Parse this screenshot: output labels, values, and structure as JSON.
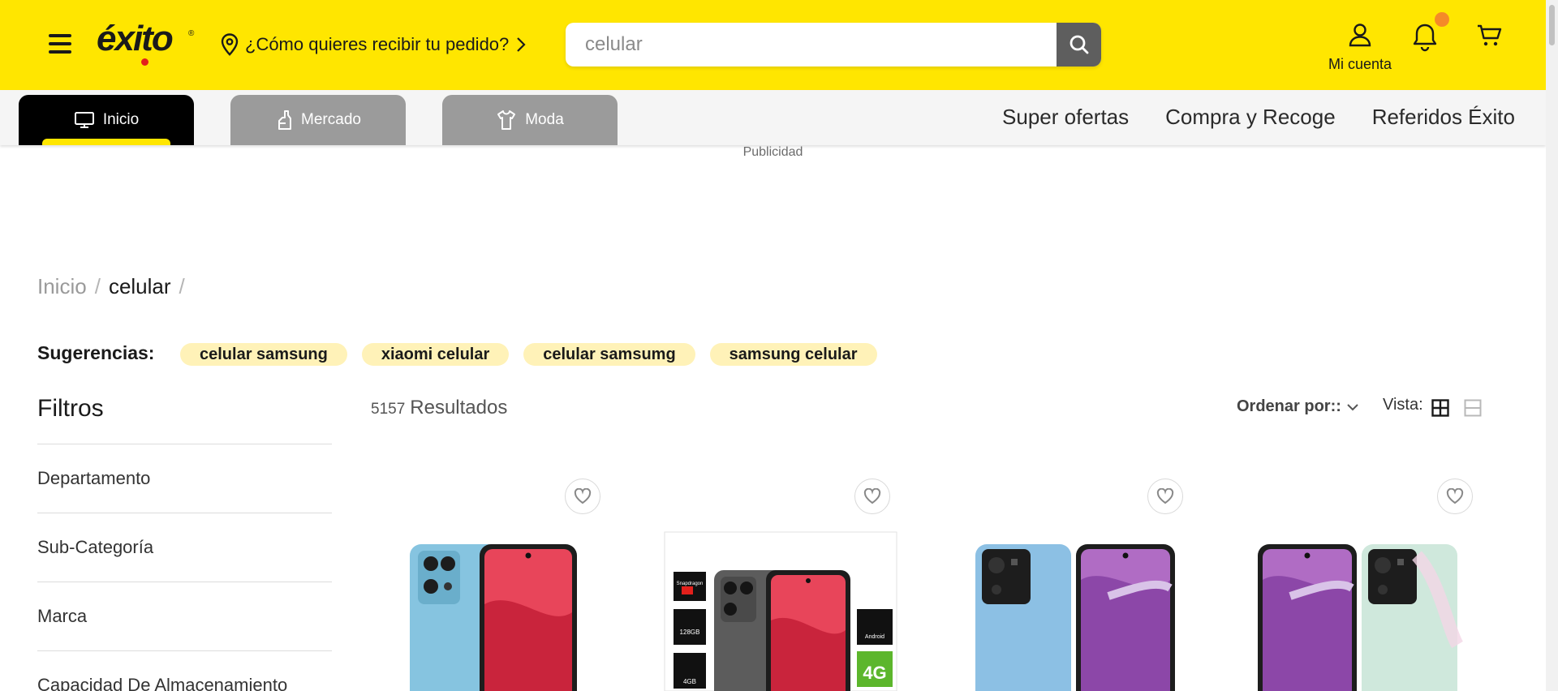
{
  "header": {
    "logo_text": "éxito",
    "logo_reg": "®",
    "delivery_prompt": "¿Cómo quieres recibir tu pedido?",
    "search": {
      "value": "",
      "placeholder": "celular"
    },
    "account_label": "Mi cuenta",
    "brand_color": "#ffe600",
    "notification_dot_color": "#f58a28"
  },
  "nav": {
    "tabs": [
      {
        "label": "Inicio",
        "icon": "monitor-icon",
        "active": true
      },
      {
        "label": "Mercado",
        "icon": "bottle-icon",
        "active": false
      },
      {
        "label": "Moda",
        "icon": "shirt-icon",
        "active": false
      }
    ],
    "links": [
      "Super ofertas",
      "Compra y Recoge",
      "Referidos Éxito"
    ]
  },
  "ad_label": "Publicidad",
  "breadcrumb": {
    "home": "Inicio",
    "separator": "/",
    "current": "celular"
  },
  "suggestions": {
    "label": "Sugerencias:",
    "chips": [
      "celular samsung",
      "xiaomi celular",
      "celular samsumg",
      "samsung celular"
    ]
  },
  "filters": {
    "title": "Filtros",
    "items": [
      "Departamento",
      "Sub-Categoría",
      "Marca",
      "Capacidad De Almacenamiento"
    ]
  },
  "results": {
    "count": "5157",
    "label": "Resultados"
  },
  "sort": {
    "label": "Ordenar por::"
  },
  "view": {
    "label": "Vista:"
  },
  "products": [
    {
      "image": "phone-blue-red-icon"
    },
    {
      "image": "phone-gray-specs-icon",
      "badge": "4G",
      "storage": "128GB",
      "ram": "4GB",
      "chip": "Snapdragon",
      "os": "Android"
    },
    {
      "image": "phone-blue-purple-icon"
    },
    {
      "image": "phone-mint-purple-icon"
    }
  ]
}
